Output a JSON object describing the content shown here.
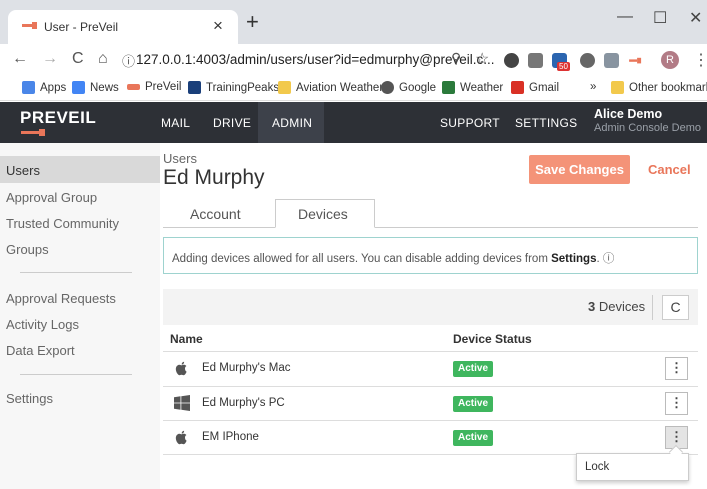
{
  "browser": {
    "tab_title": "User - PreVeil",
    "new_tab": "+",
    "close_tab": "×",
    "url": "127.0.0.1:4003/admin/users/user?id=edmurphy@preveil.c...",
    "profile_initial": "R",
    "win_min": "—",
    "win_max": "☐",
    "win_close": "✕",
    "back": "←",
    "forward": "→",
    "reload": "C",
    "home": "⌂",
    "info": "ⓘ",
    "zoom": "⚲",
    "star": "☆",
    "menu": "⋮",
    "ext_badge": "50",
    "bookmarks_more": "»",
    "bookmarks": [
      "Apps",
      "News",
      "PreVeil",
      "TrainingPeaks",
      "Aviation Weather",
      "Google",
      "Weather",
      "Gmail"
    ],
    "other_bookmarks": "Other bookmarks"
  },
  "app": {
    "logo": "PREVEIL",
    "nav": [
      "MAIL",
      "DRIVE",
      "ADMIN",
      "SUPPORT",
      "SETTINGS"
    ],
    "user_name": "Alice Demo",
    "user_sub": "Admin Console Demo"
  },
  "sidebar": {
    "items": [
      "Users",
      "Approval Group",
      "Trusted Community",
      "Groups"
    ],
    "items2": [
      "Approval Requests",
      "Activity Logs",
      "Data Export"
    ],
    "items3": [
      "Settings"
    ]
  },
  "page": {
    "breadcrumb": "Users",
    "title": "Ed Murphy",
    "save_label": "Save Changes",
    "cancel_label": "Cancel",
    "tabs": [
      "Account",
      "Devices"
    ],
    "info_prefix": "Adding devices allowed for all users. You can disable adding devices from ",
    "info_link": "Settings",
    "info_suffix": ".",
    "info_icon": "ⓘ",
    "device_count": "3",
    "device_count_label": "Devices",
    "refresh": "C",
    "col_name": "Name",
    "col_status": "Device Status",
    "kebab": "⋮",
    "devices": [
      {
        "name": "Ed Murphy's Mac",
        "status": "Active",
        "icon": "apple-icon"
      },
      {
        "name": "Ed Murphy's PC",
        "status": "Active",
        "icon": "windows-icon"
      },
      {
        "name": "EM IPhone",
        "status": "Active",
        "icon": "apple-icon"
      }
    ],
    "menu_item": "Lock"
  },
  "colors": {
    "accent": "#f49378",
    "nav_bg": "#2d3036",
    "active_badge": "#3fb65e",
    "info_border": "#9ed3cf"
  }
}
